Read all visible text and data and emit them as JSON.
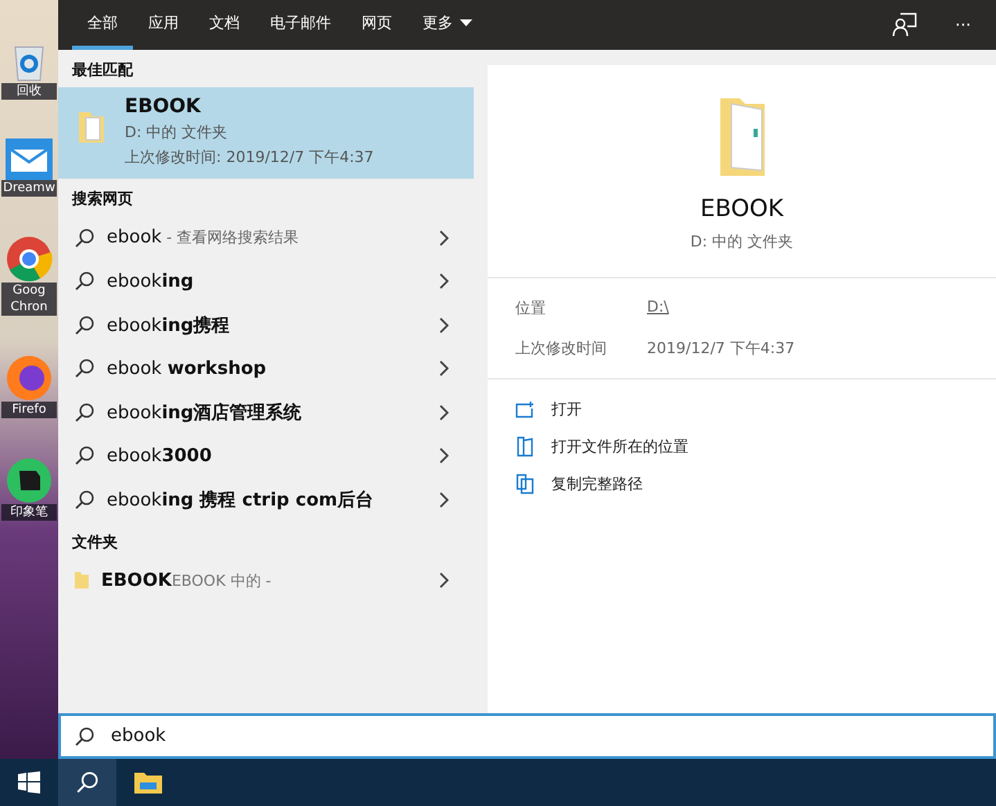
{
  "desktop": {
    "icons": [
      {
        "kind": "recycle",
        "label": "回收"
      },
      {
        "kind": "mail",
        "label": "Dreamw"
      },
      {
        "kind": "chrome",
        "label": "Goog Chron"
      },
      {
        "kind": "firefox",
        "label": "Firefo"
      },
      {
        "kind": "evernote",
        "label": "印象笔"
      }
    ]
  },
  "tabs": [
    {
      "label": "全部",
      "selected": true
    },
    {
      "label": "应用",
      "selected": false
    },
    {
      "label": "文档",
      "selected": false
    },
    {
      "label": "电子邮件",
      "selected": false
    },
    {
      "label": "网页",
      "selected": false
    },
    {
      "label": "更多",
      "selected": false,
      "dropdown": true
    }
  ],
  "more_button": "···",
  "best_match": {
    "heading": "最佳匹配",
    "title": "EBOOK",
    "subtitle": "D: 中的 文件夹",
    "modified": "上次修改时间: 2019/12/7 下午4:37",
    "selected": true
  },
  "web": {
    "heading": "搜索网页",
    "items": [
      {
        "query": "ebook",
        "hint": " - 查看网络搜索结果"
      },
      {
        "query": "ebook**ing**"
      },
      {
        "query": "ebook**ing携程**"
      },
      {
        "query": "ebook **workshop**"
      },
      {
        "query": "ebook**ing酒店管理系统**"
      },
      {
        "query": "ebook**3000**"
      },
      {
        "query": "ebook**ing 携程 ctrip com后台**"
      }
    ]
  },
  "folders": {
    "heading": "文件夹",
    "items": [
      {
        "name": "EBOOK",
        "hint": "EBOOK 中的 -"
      }
    ]
  },
  "preview": {
    "title": "EBOOK",
    "subtitle": "D: 中的 文件夹",
    "properties": [
      {
        "label": "位置",
        "value": "D:\\",
        "link": true
      },
      {
        "label": "上次修改时间",
        "value": "2019/12/7 下午4:37",
        "link": false
      }
    ],
    "actions": [
      {
        "kind": "open",
        "label": "打开"
      },
      {
        "kind": "location",
        "label": "打开文件所在的位置"
      },
      {
        "kind": "copy",
        "label": "复制完整路径"
      }
    ]
  },
  "search": {
    "value": "ebook"
  }
}
